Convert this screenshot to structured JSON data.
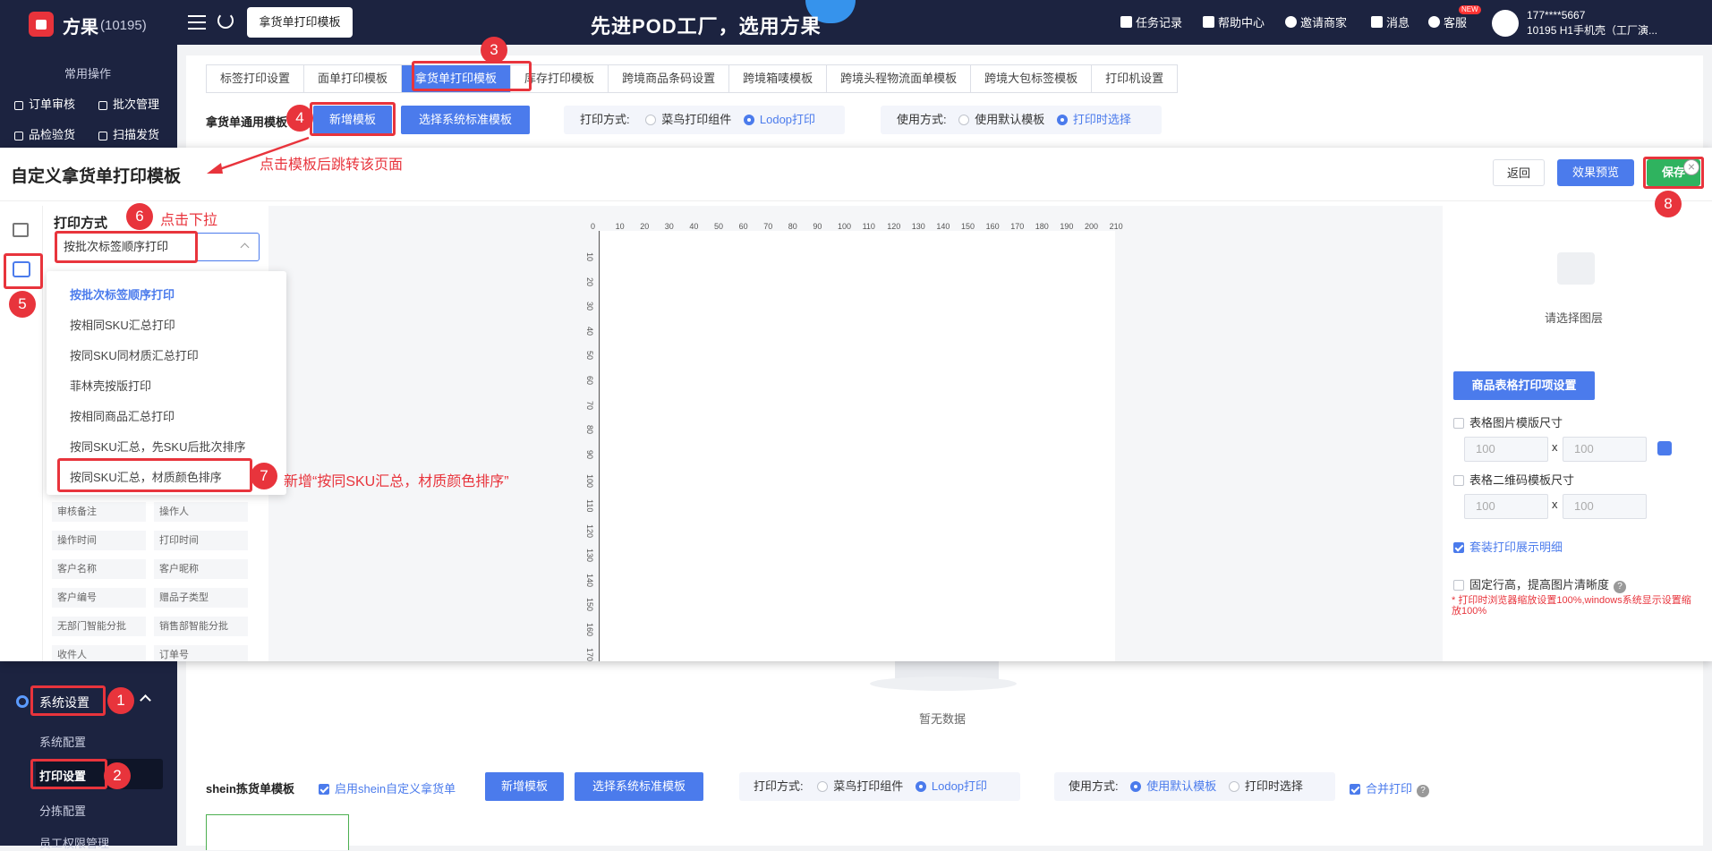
{
  "header": {
    "brand": "方果",
    "brand_count": "(10195)",
    "active_tab": "拿货单打印模板",
    "slogan": "先进POD工厂，选用方果",
    "links": [
      "任务记录",
      "帮助中心",
      "邀请商家",
      "消息",
      "客服"
    ],
    "new_badge": "NEW",
    "user_phone": "177****5667",
    "user_shop": "10195 H1手机壳（工厂演..."
  },
  "sidebar": {
    "section_title": "常用操作",
    "quick": [
      "订单审核",
      "批次管理",
      "品检验货",
      "扫描发货"
    ],
    "system_settings": "系统设置",
    "items": [
      "系统配置",
      "打印设置",
      "分拣配置",
      "员工权限管理"
    ]
  },
  "main": {
    "tabs": [
      "标签打印设置",
      "面单打印模板",
      "拿货单打印模板",
      "库存打印模板",
      "跨境商品条码设置",
      "跨境箱唛模板",
      "跨境头程物流面单模板",
      "跨境大包标签模板",
      "打印机设置"
    ],
    "section_label": "拿货单通用模板",
    "new_template": "新增模板",
    "select_standard": "选择系统标准模板",
    "print_mode_label": "打印方式:",
    "print_opt1": "菜鸟打印组件",
    "print_opt2": "Lodop打印",
    "use_mode_label": "使用方式:",
    "use_opt1": "使用默认模板",
    "use_opt2": "打印时选择",
    "no_data": "暂无数据",
    "shein_label": "shein拣货单模板",
    "shein_enable": "启用shein自定义拿货单",
    "merge_print": "合并打印"
  },
  "modal": {
    "title": "自定义拿货单打印模板",
    "back": "返回",
    "preview": "效果预览",
    "save": "保存",
    "print_mode_title": "打印方式",
    "select_value": "按批次标签顺序打印",
    "options": [
      "按批次标签顺序打印",
      "按相同SKU汇总打印",
      "按同SKU同材质汇总打印",
      "菲林壳按版打印",
      "按相同商品汇总打印",
      "按同SKU汇总，先SKU后批次排序",
      "按同SKU汇总，材质颜色排序"
    ],
    "fields": [
      [
        "审核备注",
        "操作人"
      ],
      [
        "操作时间",
        "打印时间"
      ],
      [
        "客户名称",
        "客户昵称"
      ],
      [
        "客户编号",
        "赠品子类型"
      ],
      [
        "无部门智能分批",
        "销售部智能分批"
      ],
      [
        "收件人",
        "订单号"
      ]
    ],
    "ruler_h": [
      "0",
      "10",
      "20",
      "30",
      "40",
      "50",
      "60",
      "70",
      "80",
      "90",
      "100",
      "110",
      "120",
      "130",
      "140",
      "150",
      "160",
      "170",
      "180",
      "190",
      "200",
      "210"
    ],
    "ruler_v": [
      "10",
      "20",
      "30",
      "40",
      "50",
      "60",
      "70",
      "80",
      "90",
      "100",
      "110",
      "120",
      "130",
      "140",
      "150",
      "160",
      "170"
    ],
    "select_layer": "请选择图层",
    "table_settings": "商品表格打印项设置",
    "img_size_label": "表格图片模版尺寸",
    "qr_size_label": "表格二维码模板尺寸",
    "size_value": "100",
    "times": "x",
    "suit_detail": "套装打印展示明细",
    "fixed_row": "固定行高，提高图片清晰度",
    "warning": "* 打印时浏览器缩放设置100%,windows系统显示设置缩放100%"
  },
  "annotations": {
    "n1": "1",
    "n2": "2",
    "n3": "3",
    "n4": "4",
    "n5": "5",
    "n6": "6",
    "n7": "7",
    "n8": "8",
    "jump_note": "点击模板后跳转该页面",
    "dropdown_note": "点击下拉",
    "new_option_note": "新增“按同SKU汇总，材质颜色排序”"
  },
  "colors": {
    "accent": "#4b7bec",
    "annotation_red": "#e8343c",
    "sidebar": "#1c2340",
    "save_green": "#2fb35f"
  }
}
